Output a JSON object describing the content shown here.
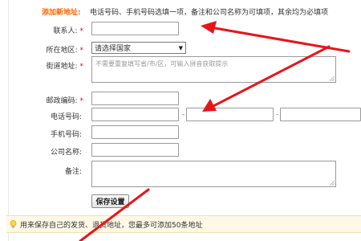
{
  "form": {
    "title": "添加新地址:",
    "description": "电话号码、手机号码选填一项，备注和公司名称为可填项，其余均为必填项",
    "required_mark": "*",
    "contact_label": "联系人:",
    "region_label": "所在地区:",
    "region_selected": "请选择国家",
    "street_label": "街道地址:",
    "street_placeholder": "不需要重复填写省/市/区，可输入拼音获取提示",
    "postcode_label": "邮政编码:",
    "phone_label": "电话号码:",
    "phone_separator": "-",
    "mobile_label": "手机号码:",
    "company_label": "公司名称:",
    "note_label": "备注:",
    "save_button": "保存设置"
  },
  "tip": {
    "text": "用来保存自己的发货、退货地址，您最多可添加50条地址",
    "icon": "lightbulb-icon"
  },
  "colors": {
    "title": "#ff6600",
    "required": "#e60012",
    "annotation_arrow": "#e8141a",
    "tip_background": "#fff8e6"
  }
}
